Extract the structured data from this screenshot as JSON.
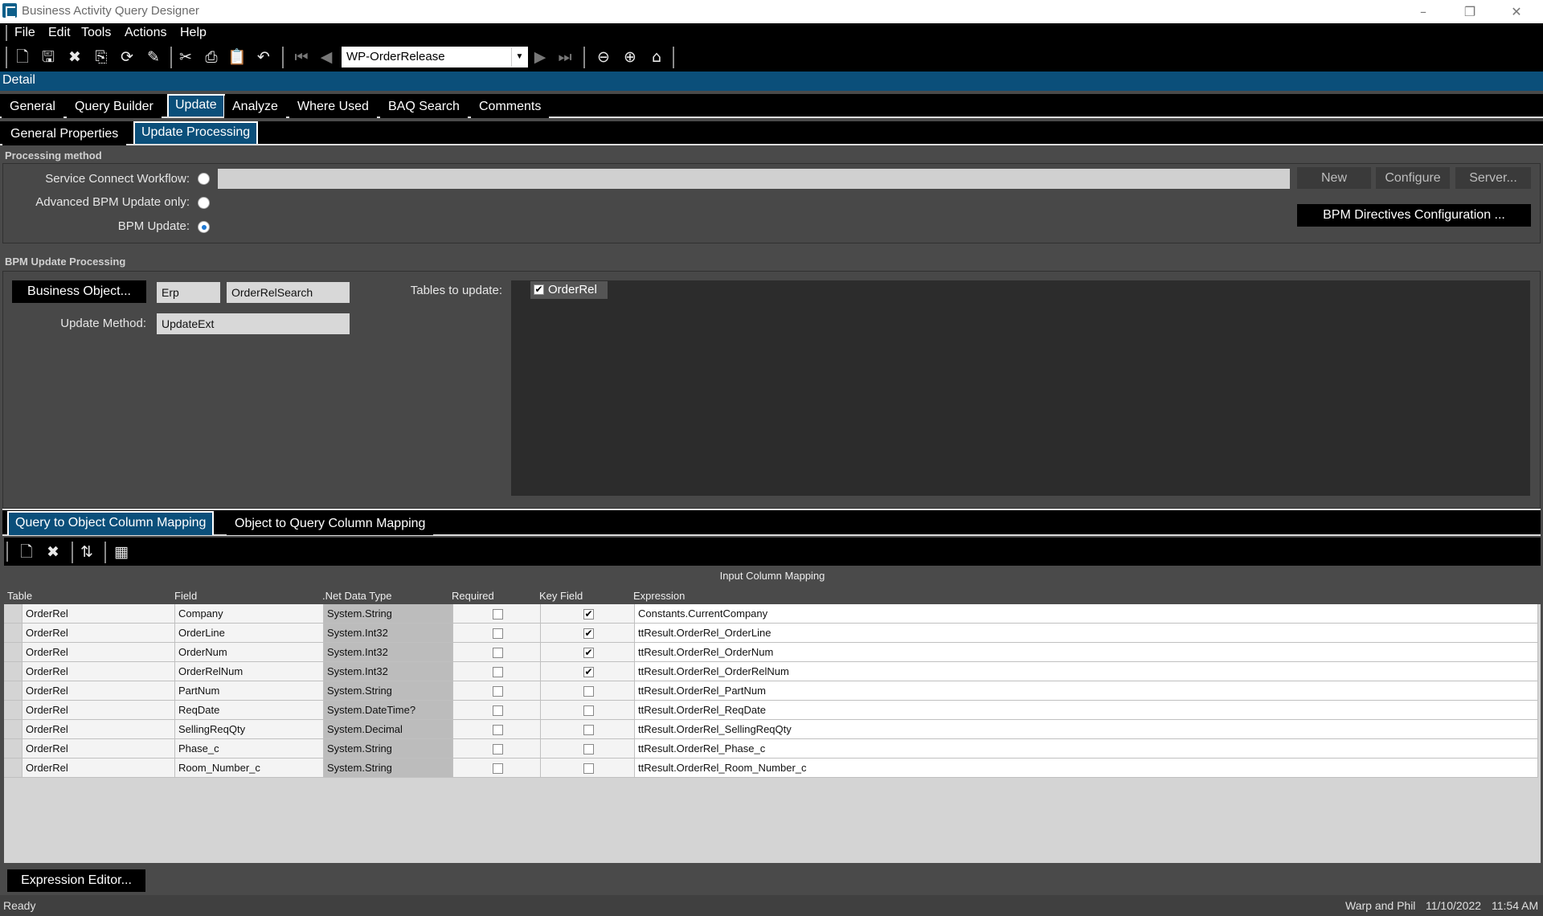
{
  "window": {
    "title": "Business Activity Query Designer",
    "minimize": "–",
    "restore": "❐",
    "close": "✕"
  },
  "menu": [
    "File",
    "Edit",
    "Tools",
    "Actions",
    "Help"
  ],
  "toolbar": {
    "record": "WP-OrderRelease"
  },
  "detail_label": "Detail",
  "tabs": [
    "General",
    "Query Builder",
    "Update",
    "Analyze",
    "Where Used",
    "BAQ Search",
    "Comments"
  ],
  "active_tab": "Update",
  "subtabs": [
    "General Properties",
    "Update  Processing"
  ],
  "active_subtab": "Update  Processing",
  "processing": {
    "header": "Processing method",
    "service_connect_label": "Service Connect Workflow:",
    "advanced_bpm_label": "Advanced BPM Update only:",
    "bpm_update_label": "BPM Update:",
    "selected": "BPM Update",
    "new_button": "New",
    "configure_button": "Configure",
    "server_button": "Server...",
    "bpm_directives_button": "BPM Directives Configuration ..."
  },
  "bpm": {
    "header": "BPM Update Processing",
    "business_object_button": "Business Object...",
    "bo_system": "Erp",
    "bo_name": "OrderRelSearch",
    "update_method_label": "Update Method:",
    "update_method": "UpdateExt",
    "tables_label": "Tables to update:",
    "tables": [
      {
        "name": "OrderRel",
        "checked": true
      }
    ]
  },
  "mapping_tabs": [
    "Query to Object Column Mapping",
    "Object to Query Column Mapping"
  ],
  "active_mapping_tab": "Query to Object Column Mapping",
  "grid": {
    "caption": "Input Column Mapping",
    "columns": [
      "Table",
      "Field",
      ".Net Data Type",
      "Required",
      "Key Field",
      "Expression"
    ],
    "rows": [
      {
        "table": "OrderRel",
        "field": "Company",
        "type": "System.String",
        "required": false,
        "key": true,
        "expression": "Constants.CurrentCompany"
      },
      {
        "table": "OrderRel",
        "field": "OrderLine",
        "type": "System.Int32",
        "required": false,
        "key": true,
        "expression": "ttResult.OrderRel_OrderLine"
      },
      {
        "table": "OrderRel",
        "field": "OrderNum",
        "type": "System.Int32",
        "required": false,
        "key": true,
        "expression": "ttResult.OrderRel_OrderNum"
      },
      {
        "table": "OrderRel",
        "field": "OrderRelNum",
        "type": "System.Int32",
        "required": false,
        "key": true,
        "expression": "ttResult.OrderRel_OrderRelNum"
      },
      {
        "table": "OrderRel",
        "field": "PartNum",
        "type": "System.String",
        "required": false,
        "key": false,
        "expression": "ttResult.OrderRel_PartNum"
      },
      {
        "table": "OrderRel",
        "field": "ReqDate",
        "type": "System.DateTime?",
        "required": false,
        "key": false,
        "expression": "ttResult.OrderRel_ReqDate"
      },
      {
        "table": "OrderRel",
        "field": "SellingReqQty",
        "type": "System.Decimal",
        "required": false,
        "key": false,
        "expression": "ttResult.OrderRel_SellingReqQty"
      },
      {
        "table": "OrderRel",
        "field": "Phase_c",
        "type": "System.String",
        "required": false,
        "key": false,
        "expression": "ttResult.OrderRel_Phase_c"
      },
      {
        "table": "OrderRel",
        "field": "Room_Number_c",
        "type": "System.String",
        "required": false,
        "key": false,
        "expression": "ttResult.OrderRel_Room_Number_c"
      }
    ]
  },
  "expression_editor_button": "Expression Editor...",
  "status": {
    "text": "Ready",
    "user": "Warp and Phil",
    "date": "11/10/2022",
    "time": "11:54 AM"
  }
}
